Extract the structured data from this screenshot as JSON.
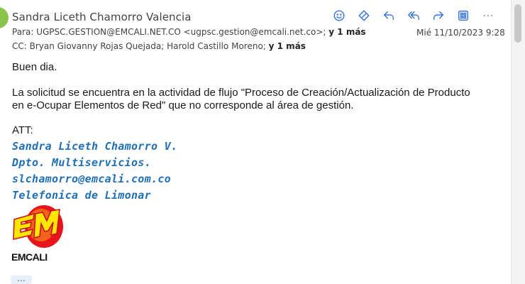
{
  "header": {
    "sender": "Sandra Liceth Chamorro Valencia",
    "to_label": "Para:",
    "to_value": "UGPSC.GESTION@EMCALI.NET.CO <ugpsc.gestion@emcali.net.co>;",
    "to_more": "y 1 más",
    "cc_label": "CC:",
    "cc_value": "Bryan Giovanny Rojas Quejada;  Harold Castillo Moreno;",
    "cc_more": "y 1 más",
    "date": "Mié 11/10/2023 9:28"
  },
  "toolbar": {
    "icons": [
      "emoji-icon",
      "tag-icon",
      "reply-icon",
      "reply-all-icon",
      "forward-icon",
      "apps-icon",
      "more-icon"
    ],
    "accent": "#2f6fd6"
  },
  "body": {
    "greeting": "Buen dia.",
    "paragraph": "La solicitud se encuentra en la actividad de flujo \"Proceso de Creación/Actualización de Producto en e-Ocupar Elementos de Red\" que no corresponde al área de gestión.",
    "att": "ATT:",
    "signature": [
      "Sandra Liceth Chamorro V.",
      "Dpto. Multiservicios.",
      "slchamorro@emcali.com.co",
      "Telefonica de Limonar"
    ],
    "signature_color": "#1f6fb5",
    "logo_text": "EMCALI",
    "show_more": "..."
  }
}
